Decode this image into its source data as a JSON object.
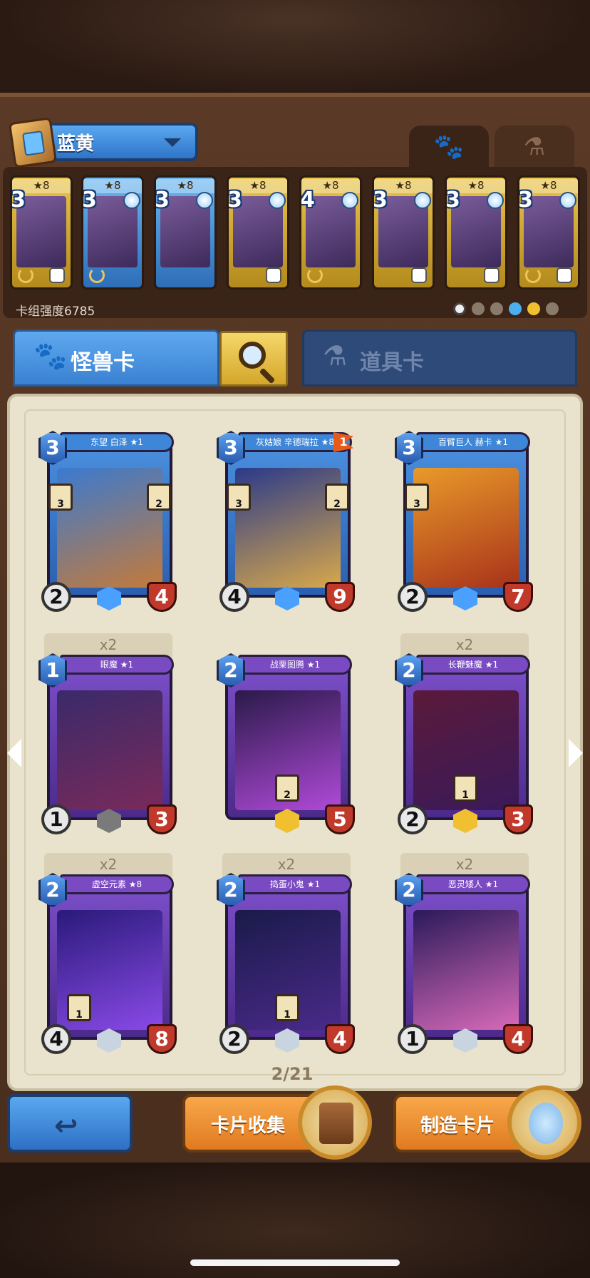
{
  "deck": {
    "name": "蓝黄",
    "power_label": "卡组强度6785"
  },
  "top_tabs": [
    {
      "icon": "paw-icon",
      "glyph": "🐾"
    },
    {
      "icon": "flask-icon",
      "glyph": "⚗"
    }
  ],
  "deck_cards": [
    {
      "cost": "3",
      "level": "★8",
      "color": "gold"
    },
    {
      "cost": "3",
      "level": "★8",
      "color": "blue"
    },
    {
      "cost": "3",
      "level": "★8",
      "color": "blue"
    },
    {
      "cost": "3",
      "level": "★8",
      "color": "gold"
    },
    {
      "cost": "4",
      "level": "★8",
      "color": "gold"
    },
    {
      "cost": "3",
      "level": "★8",
      "color": "gold"
    },
    {
      "cost": "3",
      "level": "★8",
      "color": "gold"
    },
    {
      "cost": "3",
      "level": "★8",
      "color": "gold"
    }
  ],
  "category_tabs": {
    "monster": "怪兽卡",
    "item": "道具卡"
  },
  "cards": [
    {
      "name": "东望 白泽 ★1",
      "cost": "3",
      "atk": "2",
      "hp": "4",
      "skill1": "3",
      "skill2": "2",
      "copies": "",
      "flag": ""
    },
    {
      "name": "灰姑娘 辛德瑞拉 ★8",
      "cost": "3",
      "atk": "4",
      "hp": "9",
      "skill1": "3",
      "skill2": "2",
      "copies": "",
      "flag": "1"
    },
    {
      "name": "百臂巨人 赫卡 ★1",
      "cost": "3",
      "atk": "2",
      "hp": "7",
      "skill1": "3",
      "skill2": "",
      "copies": "",
      "flag": ""
    },
    {
      "name": "眼魔 ★1",
      "cost": "1",
      "atk": "1",
      "hp": "3",
      "skill1": "",
      "skill2": "",
      "copies": "x2",
      "flag": ""
    },
    {
      "name": "战栗图腾 ★1",
      "cost": "2",
      "atk": "",
      "hp": "5",
      "skill1": "2",
      "skill2": "",
      "copies": "",
      "flag": ""
    },
    {
      "name": "长鞭魅魔 ★1",
      "cost": "2",
      "atk": "2",
      "hp": "3",
      "skill1": "1",
      "skill2": "",
      "copies": "x2",
      "flag": ""
    },
    {
      "name": "虚空元素 ★8",
      "cost": "2",
      "atk": "4",
      "hp": "8",
      "skill1": "1",
      "skill2": "",
      "copies": "x2",
      "flag": ""
    },
    {
      "name": "捣蛋小鬼 ★1",
      "cost": "2",
      "atk": "2",
      "hp": "4",
      "skill1": "1",
      "skill2": "",
      "copies": "x2",
      "flag": ""
    },
    {
      "name": "恶灵矮人 ★1",
      "cost": "2",
      "atk": "1",
      "hp": "4",
      "skill1": "",
      "skill2": "",
      "copies": "x2",
      "flag": ""
    }
  ],
  "pager": {
    "label": "2/21"
  },
  "buttons": {
    "collect": "卡片收集",
    "craft": "制造卡片"
  },
  "colors": {
    "blue_accent": "#3a82d2",
    "orange_button": "#f08c30",
    "paper": "#e9e2cc"
  }
}
